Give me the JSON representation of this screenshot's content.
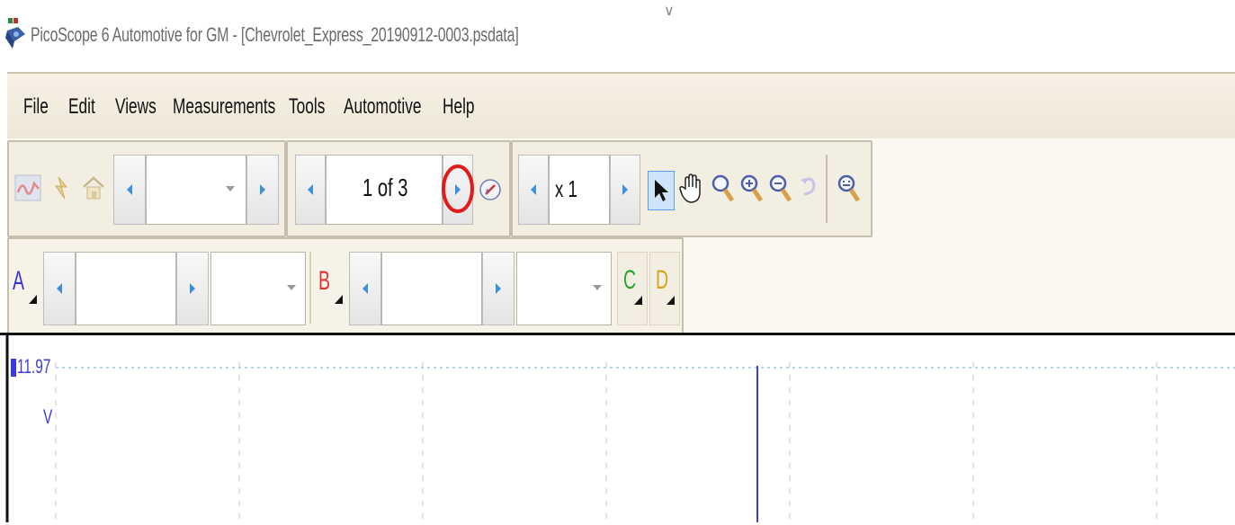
{
  "window": {
    "title": "PicoScope 6 Automotive for GM - [Chevrolet_Express_20190912-0003.psdata]",
    "top_mark": "∨"
  },
  "menu": {
    "items": [
      "File",
      "Edit",
      "Views",
      "Measurements",
      "Tools",
      "Automotive",
      "Help"
    ]
  },
  "toolbar": {
    "capture_dropdown_value": "",
    "buffer_navigator": "1 of 3",
    "zoom_value": "x 1",
    "icons": [
      "scope-mode-icon",
      "trigger-icon",
      "home-icon",
      "ruler-icon",
      "pointer-icon",
      "hand-icon",
      "zoom-icon",
      "zoom-in-icon",
      "zoom-out-icon",
      "undo-zoom-icon",
      "zoom-fit-icon"
    ],
    "highlight_color": "#e11b1b"
  },
  "channels": [
    {
      "label": "A",
      "color": "#3535d8",
      "range_value": "",
      "coupling_value": ""
    },
    {
      "label": "B",
      "color": "#e03434",
      "range_value": "",
      "coupling_value": ""
    },
    {
      "label": "C",
      "color": "#2aa52a"
    },
    {
      "label": "D",
      "color": "#d8a418"
    }
  ],
  "scope": {
    "y_value": "11.97",
    "y_unit": "V",
    "trace_color": "#3b3bdc",
    "grid_color": "#9fc6d6"
  }
}
